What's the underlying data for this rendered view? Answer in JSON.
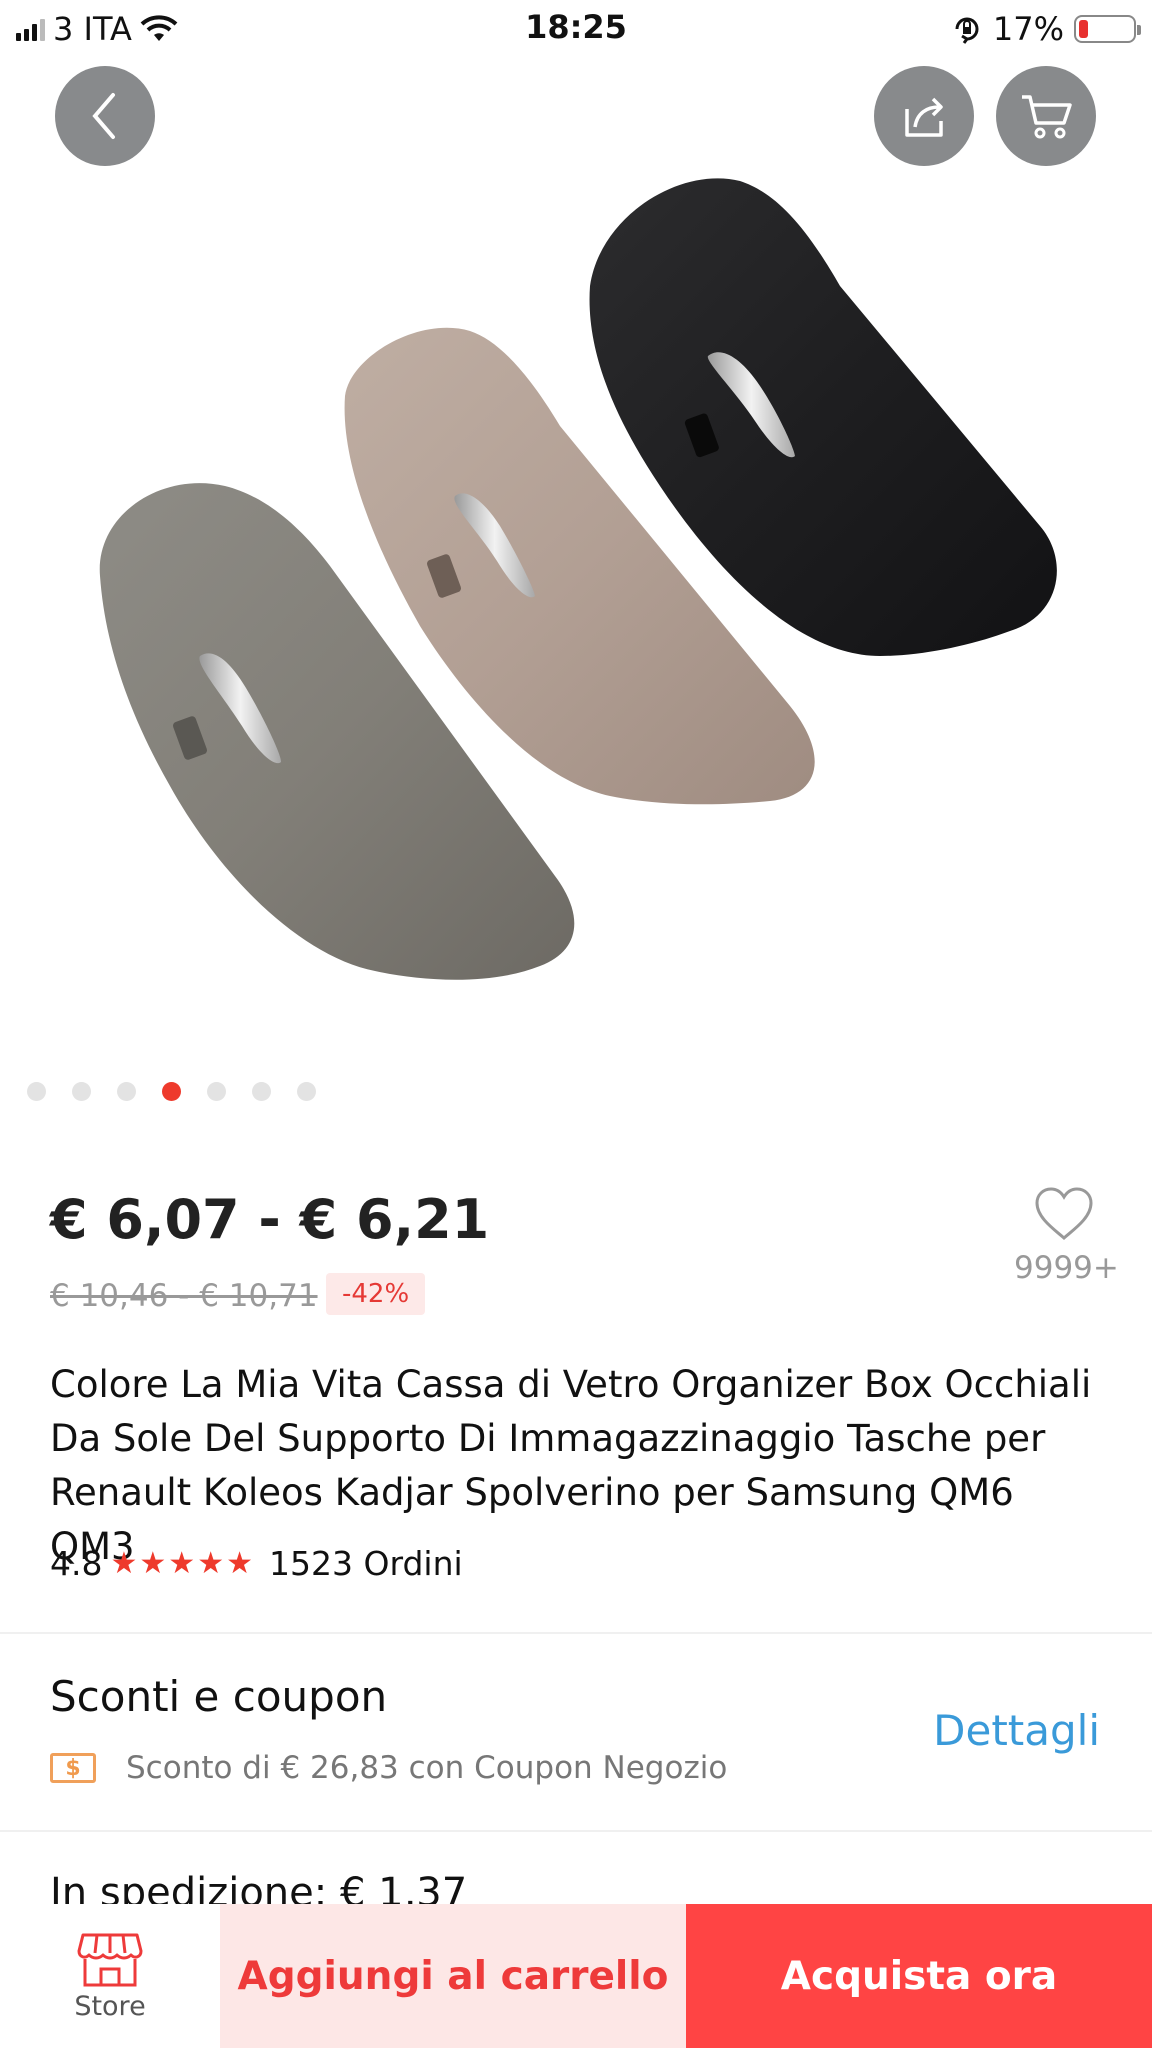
{
  "status_bar": {
    "carrier": "3 ITA",
    "time": "18:25",
    "battery_percent": "17%",
    "battery_level": 0.17,
    "battery_color": "#e8312f",
    "icons": [
      "signal-icon",
      "wifi-icon",
      "orientation-lock-icon",
      "battery-icon"
    ]
  },
  "header": {
    "icons": [
      "back-icon",
      "share-icon",
      "cart-icon"
    ]
  },
  "gallery": {
    "image_count": 7,
    "active_index": 3,
    "active_color": "#ee3a2c"
  },
  "product": {
    "price_range": "€ 6,07 - € 6,21",
    "original_price_range": "€ 10,46 - € 10,71",
    "discount": "-42%",
    "wishlist_count": "9999+",
    "title": "Colore La Mia Vita Cassa di Vetro Organizer Box Occhiali Da Sole Del Supporto Di Immagazzinaggio Tasche per Renault Koleos Kadjar Spolverino per Samsung QM6 QM3",
    "rating": "4.8",
    "stars": 5,
    "orders": "1523 Ordini"
  },
  "coupons": {
    "title": "Sconti e coupon",
    "icon_label": "$",
    "description": "Sconto di € 26,83 con Coupon Negozio",
    "details_label": "Dettagli"
  },
  "shipping": {
    "label": "In spedizione: € 1,37"
  },
  "bottom_bar": {
    "store_label": "Store",
    "add_to_cart_label": "Aggiungi al carrello",
    "buy_now_label": "Acquista ora",
    "accent_color": "#ff4444"
  }
}
